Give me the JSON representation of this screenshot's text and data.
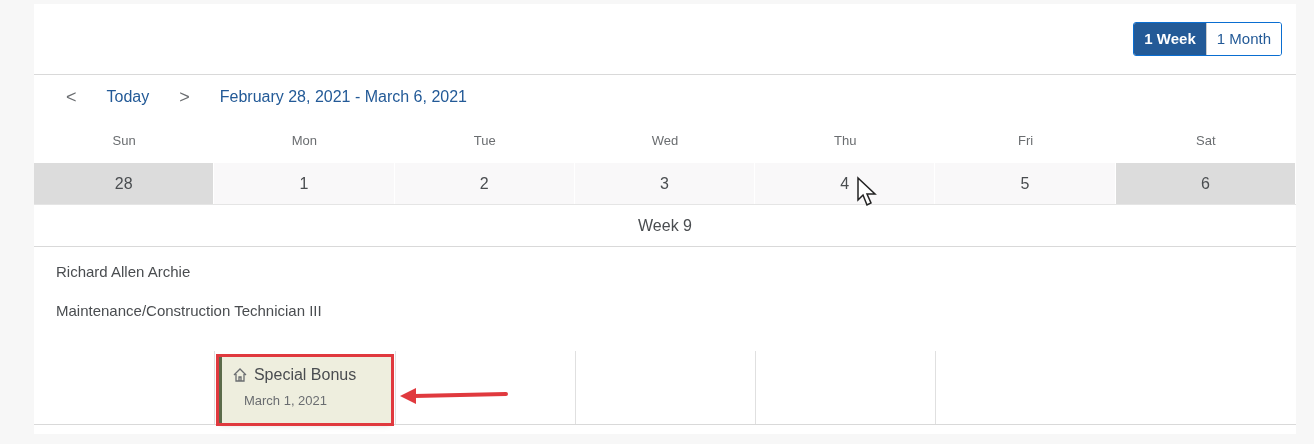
{
  "views": [
    {
      "label": "1 Week",
      "selected": true
    },
    {
      "label": "1 Month",
      "selected": false
    }
  ],
  "nav": {
    "prev": "<",
    "today": "Today",
    "next": ">",
    "range": "February 28, 2021 - March 6, 2021"
  },
  "days": [
    {
      "name": "Sun",
      "date": "28",
      "weekend": true
    },
    {
      "name": "Mon",
      "date": "1",
      "weekend": false,
      "appointments": [
        {
          "title": "Special Bonus",
          "date": "March 1, 2021",
          "highlighted": true
        }
      ]
    },
    {
      "name": "Tue",
      "date": "2",
      "weekend": false
    },
    {
      "name": "Wed",
      "date": "3",
      "weekend": false
    },
    {
      "name": "Thu",
      "date": "4",
      "weekend": false
    },
    {
      "name": "Fri",
      "date": "5",
      "weekend": false
    },
    {
      "name": "Sat",
      "date": "6",
      "weekend": true
    }
  ],
  "week_label": "Week 9",
  "employee": {
    "name": "Richard Allen Archie",
    "title": "Maintenance/Construction Technician III"
  }
}
